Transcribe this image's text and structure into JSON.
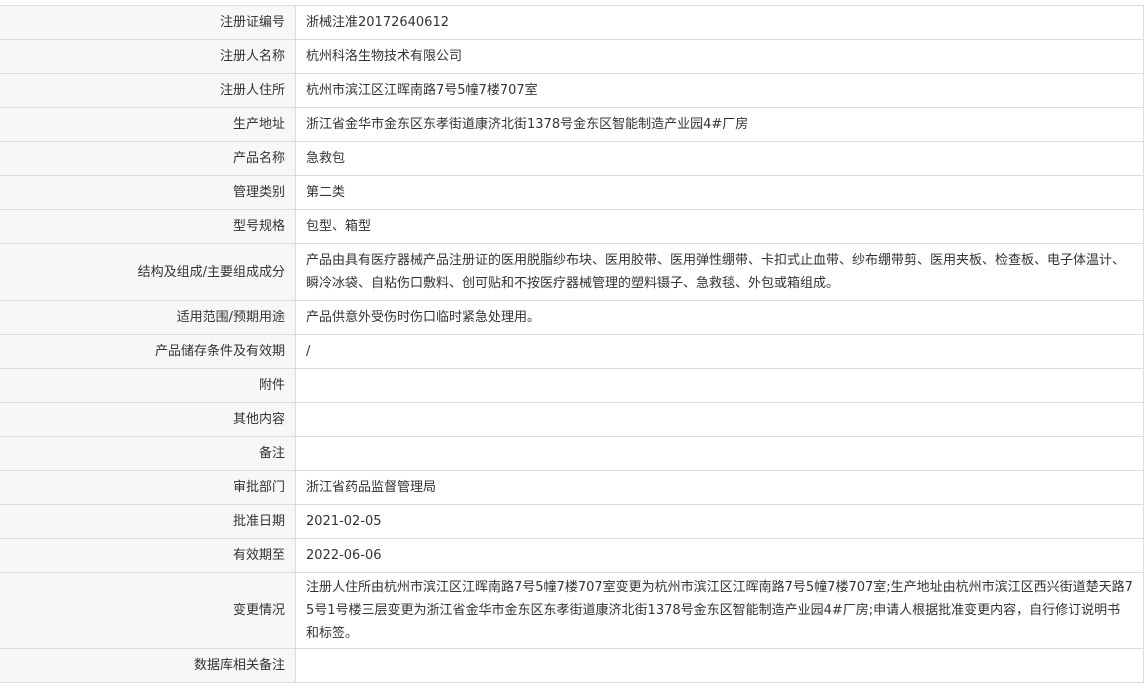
{
  "rows": [
    {
      "label": "注册证编号",
      "value": "浙械注准20172640612"
    },
    {
      "label": "注册人名称",
      "value": "杭州科洛生物技术有限公司"
    },
    {
      "label": "注册人住所",
      "value": "杭州市滨江区江晖南路7号5幢7楼707室"
    },
    {
      "label": "生产地址",
      "value": "浙江省金华市金东区东孝街道康济北街1378号金东区智能制造产业园4#厂房"
    },
    {
      "label": "产品名称",
      "value": "急救包"
    },
    {
      "label": "管理类别",
      "value": "第二类"
    },
    {
      "label": "型号规格",
      "value": "包型、箱型"
    },
    {
      "label": "结构及组成/主要组成成分",
      "value": "产品由具有医疗器械产品注册证的医用脱脂纱布块、医用胶带、医用弹性绷带、卡扣式止血带、纱布绷带剪、医用夹板、检查板、电子体温计、瞬冷冰袋、自粘伤口敷料、创可贴和不按医疗器械管理的塑料镊子、急救毯、外包或箱组成。"
    },
    {
      "label": "适用范围/预期用途",
      "value": "产品供意外受伤时伤口临时紧急处理用。"
    },
    {
      "label": "产品储存条件及有效期",
      "value": "/"
    },
    {
      "label": "附件",
      "value": ""
    },
    {
      "label": "其他内容",
      "value": ""
    },
    {
      "label": "备注",
      "value": ""
    },
    {
      "label": "审批部门",
      "value": "浙江省药品监督管理局"
    },
    {
      "label": "批准日期",
      "value": "2021-02-05"
    },
    {
      "label": "有效期至",
      "value": "2022-06-06"
    },
    {
      "label": "变更情况",
      "value": "注册人住所由杭州市滨江区江晖南路7号5幢7楼707室变更为杭州市滨江区江晖南路7号5幢7楼707室;生产地址由杭州市滨江区西兴街道楚天路75号1号楼三层变更为浙江省金华市金东区东孝街道康济北街1378号金东区智能制造产业园4#厂房;申请人根据批准变更内容，自行修订说明书和标签。"
    },
    {
      "label": "数据库相关备注",
      "value": ""
    }
  ]
}
